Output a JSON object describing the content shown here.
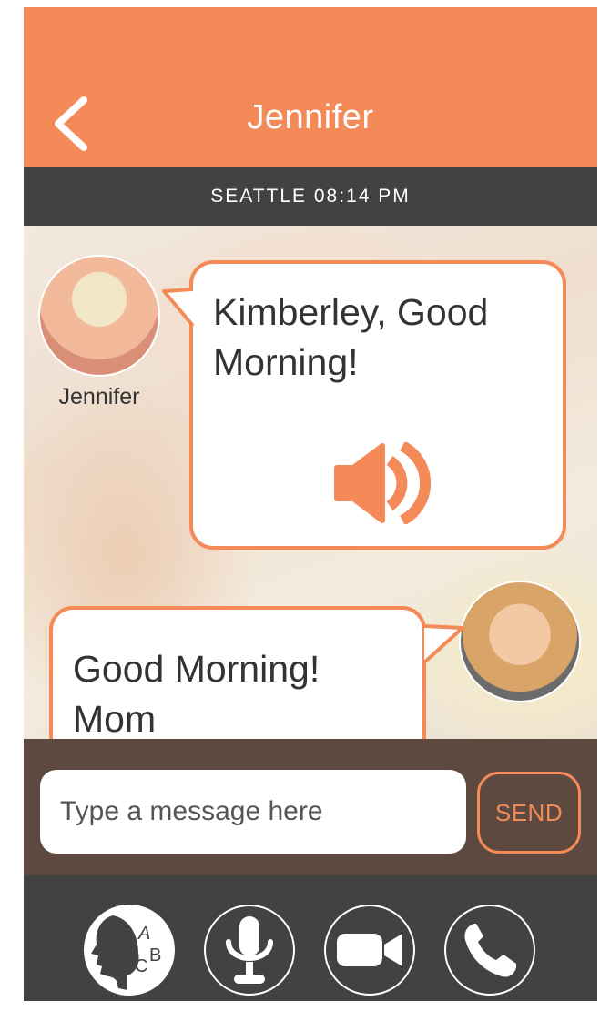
{
  "header": {
    "title": "Jennifer",
    "back_icon": "chevron-left-icon"
  },
  "status": {
    "location_time": "SEATTLE 08:14 PM"
  },
  "messages": [
    {
      "sender": "Jennifer",
      "direction": "incoming",
      "text": "Kimberley, Good Morning!",
      "action_icon": "speaker-icon"
    },
    {
      "direction": "outgoing",
      "text": "Good Morning! Mom"
    }
  ],
  "composer": {
    "placeholder": "Type a message here",
    "send_label": "SEND"
  },
  "toolbar": {
    "items": [
      {
        "icon": "speech-to-text-icon"
      },
      {
        "icon": "microphone-icon"
      },
      {
        "icon": "video-camera-icon"
      },
      {
        "icon": "phone-icon"
      }
    ]
  },
  "colors": {
    "accent": "#f48a58",
    "status_bar": "#424242",
    "composer_bg": "#5d4940",
    "toolbar_bg": "#424242"
  }
}
